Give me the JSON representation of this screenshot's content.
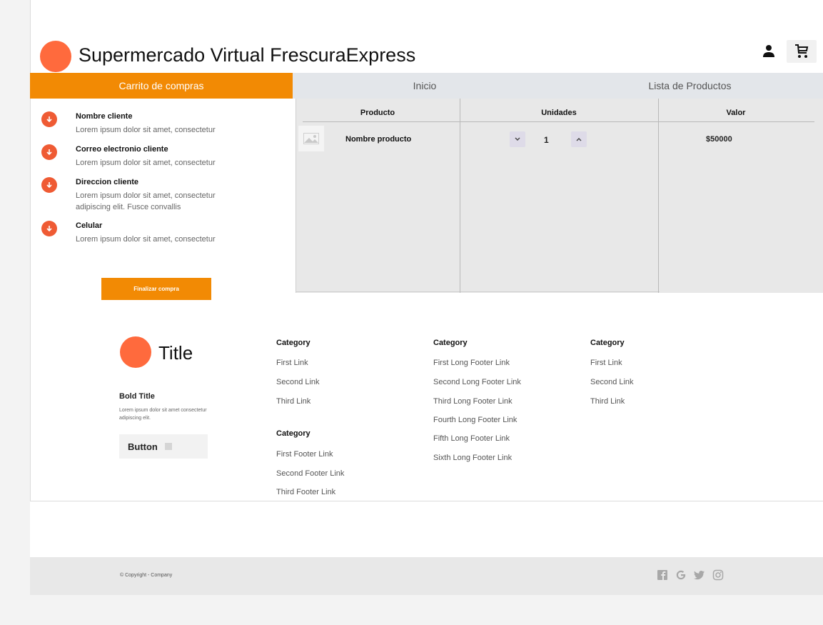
{
  "header": {
    "site_title": "Supermercado Virtual FrescuraExpress"
  },
  "nav": {
    "tabs": [
      {
        "label": "Carrito de compras",
        "active": true
      },
      {
        "label": "Inicio",
        "active": false
      },
      {
        "label": "Lista de Productos",
        "active": false
      }
    ]
  },
  "customer": {
    "items": [
      {
        "title": "Nombre cliente",
        "text": "Lorem ipsum dolor sit amet, consectetur"
      },
      {
        "title": "Correo electronio cliente",
        "text": "Lorem ipsum dolor sit amet, consectetur"
      },
      {
        "title": "Direccion cliente",
        "text": "Lorem ipsum dolor sit amet, consectetur adipiscing elit. Fusce convallis"
      },
      {
        "title": "Celular",
        "text": "Lorem ipsum dolor sit amet, consectetur"
      }
    ],
    "finalizar_label": "Finalizar compra"
  },
  "cart_table": {
    "headers": [
      "Producto",
      "Unidades",
      "Valor"
    ],
    "rows": [
      {
        "product": "Nombre producto",
        "quantity": "1",
        "value": "$50000"
      }
    ]
  },
  "footer": {
    "title": "Title",
    "bold_title": "Bold Title",
    "description": "Lorem ipsum dolor sit amet consectetur adipiscing elit.",
    "button_label": "Button",
    "columns": [
      {
        "category": "Category",
        "links": [
          "First Link",
          "Second Link",
          "Third Link"
        ]
      },
      {
        "category": "Category",
        "links": [
          "First Footer Link",
          "Second Footer Link",
          "Third Footer Link"
        ]
      },
      {
        "category": "Category",
        "links": [
          "First Long Footer Link",
          "Second Long Footer Link",
          "Third Long Footer Link",
          "Fourth Long Footer Link",
          "Fifth Long Footer Link",
          "Sixth Long Footer Link"
        ]
      },
      {
        "category": "Category",
        "links": [
          "First Link",
          "Second Link",
          "Third Link"
        ]
      }
    ]
  },
  "bottom_bar": {
    "copyright": "© Copyright - Company",
    "social_icons": [
      "facebook-icon",
      "google-icon",
      "twitter-icon",
      "instagram-icon"
    ]
  },
  "colors": {
    "accent_orange": "#f28a04",
    "logo_orange": "#ff6a3d",
    "icon_red": "#ef5b34"
  }
}
